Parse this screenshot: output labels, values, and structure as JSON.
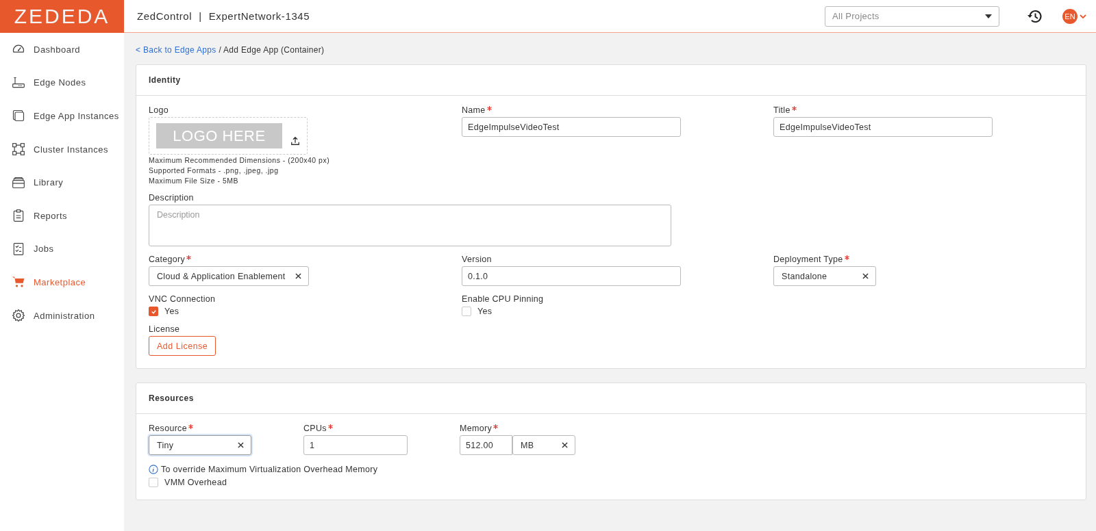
{
  "header": {
    "logo": "ZEDEDA",
    "app": "ZedControl",
    "separator": "|",
    "network": "ExpertNetwork-1345",
    "project_select": {
      "placeholder": "All Projects"
    },
    "language": "EN"
  },
  "sidebar": {
    "items": [
      {
        "label": "Dashboard",
        "selected": false
      },
      {
        "label": "Edge Nodes",
        "selected": false
      },
      {
        "label": "Edge App Instances",
        "selected": false
      },
      {
        "label": "Cluster Instances",
        "selected": false
      },
      {
        "label": "Library",
        "selected": false
      },
      {
        "label": "Reports",
        "selected": false
      },
      {
        "label": "Jobs",
        "selected": false
      },
      {
        "label": "Marketplace",
        "selected": true
      },
      {
        "label": "Administration",
        "selected": false
      }
    ]
  },
  "breadcrumb": {
    "link": "< Back to Edge Apps",
    "current": "/ Add Edge App (Container)"
  },
  "identity": {
    "title": "Identity",
    "rows": [
      [
        {
          "kind": "logo",
          "label": "Logo",
          "image_text": "LOGO HERE",
          "hints": [
            "Maximum Recommended Dimensions - (200x40 px)",
            "Supported Formats - .png, .jpeg, .jpg",
            "Maximum File Size - 5MB"
          ]
        },
        {
          "kind": "text",
          "label": "Name",
          "required": true,
          "value": "EdgeImpulseVideoTest"
        },
        {
          "kind": "text",
          "label": "Title",
          "required": true,
          "value": "EdgeImpulseVideoTest"
        }
      ],
      [
        {
          "kind": "textarea",
          "label": "Description",
          "placeholder": "Description"
        }
      ],
      [
        {
          "kind": "select",
          "label": "Category",
          "required": true,
          "value": "Cloud & Application Enablement",
          "focused": false
        },
        {
          "kind": "text",
          "label": "Version",
          "required": false,
          "value": "0.1.0"
        },
        {
          "kind": "select",
          "label": "Deployment Type",
          "required": true,
          "value": "Standalone",
          "focused": false
        }
      ],
      [
        {
          "kind": "checkbox",
          "label": "VNC Connection",
          "option": "Yes",
          "checked": true
        },
        {
          "kind": "checkbox",
          "label": "Enable CPU Pinning",
          "option": "Yes",
          "checked": false
        }
      ],
      [
        {
          "kind": "button",
          "label": "License",
          "button": "Add License"
        }
      ]
    ]
  },
  "resources": {
    "title": "Resources",
    "fields": [
      {
        "kind": "select",
        "label": "Resource",
        "required": true,
        "value": "Tiny",
        "focused": true
      },
      {
        "kind": "text",
        "label": "CPUs",
        "required": true,
        "value": "1"
      },
      {
        "kind": "unit",
        "label": "Memory",
        "required": true,
        "value": "512.00",
        "unit": "MB"
      }
    ],
    "note": "To override Maximum Virtualization Overhead Memory",
    "option": {
      "label": "VMM Overhead",
      "checked": false
    }
  }
}
